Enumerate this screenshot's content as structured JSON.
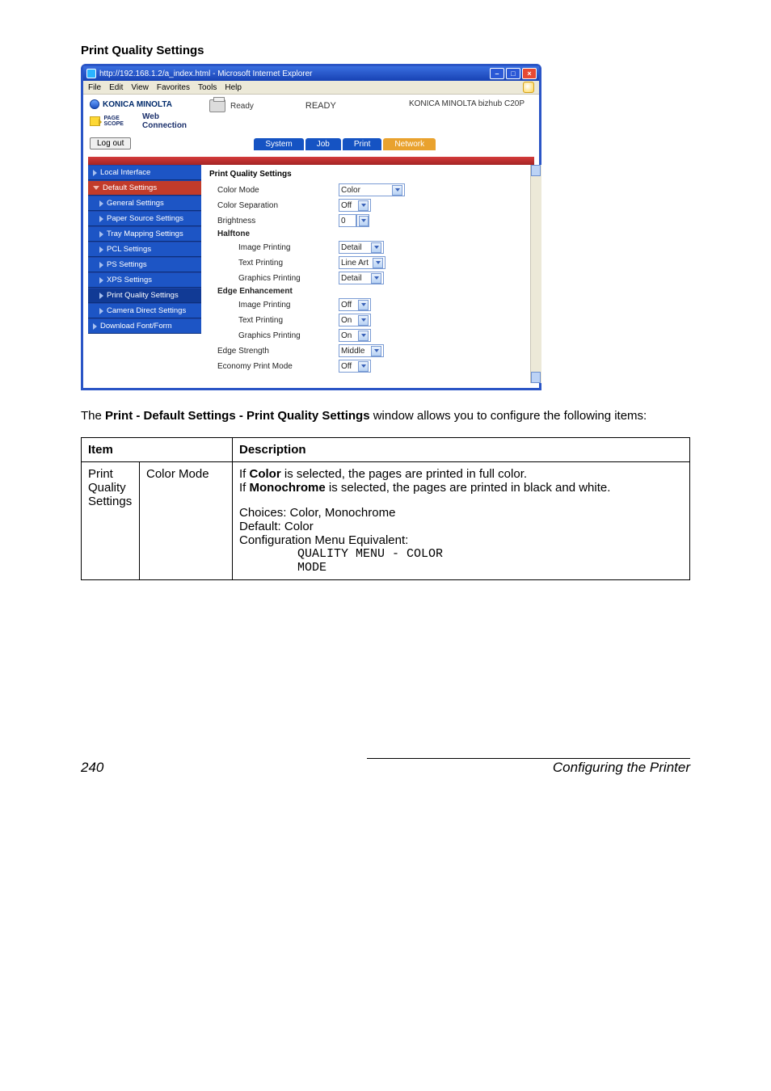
{
  "heading": "Print Quality Settings",
  "browser": {
    "title": "http://192.168.1.2/a_index.html - Microsoft Internet Explorer",
    "menu": {
      "file": "File",
      "edit": "Edit",
      "view": "View",
      "favorites": "Favorites",
      "tools": "Tools",
      "help": "Help"
    }
  },
  "header": {
    "brand": "KONICA MINOLTA",
    "pagescope_prefix": "PAGE SCOPE",
    "pagescope": "Web Connection",
    "status_small": "Ready",
    "status_big": "READY",
    "model": "KONICA MINOLTA bizhub C20P",
    "logout": "Log out"
  },
  "tabs": {
    "system": "System",
    "job": "Job",
    "print": "Print",
    "network": "Network"
  },
  "sidebar": {
    "local_interface": "Local Interface",
    "default_settings": "Default Settings",
    "general": "General Settings",
    "paper_source": "Paper Source Settings",
    "tray_mapping": "Tray Mapping Settings",
    "pcl": "PCL Settings",
    "ps": "PS Settings",
    "xps": "XPS Settings",
    "print_quality": "Print Quality Settings",
    "camera": "Camera Direct Settings",
    "download": "Download Font/Form"
  },
  "pane": {
    "title": "Print Quality Settings",
    "color_mode": {
      "label": "Color Mode",
      "value": "Color"
    },
    "color_sep": {
      "label": "Color Separation",
      "value": "Off"
    },
    "brightness": {
      "label": "Brightness",
      "value": "0"
    },
    "halftone": {
      "label": "Halftone",
      "image": {
        "label": "Image Printing",
        "value": "Detail"
      },
      "text": {
        "label": "Text Printing",
        "value": "Line Art"
      },
      "graphics": {
        "label": "Graphics Printing",
        "value": "Detail"
      }
    },
    "edge": {
      "label": "Edge Enhancement",
      "image": {
        "label": "Image Printing",
        "value": "Off"
      },
      "text": {
        "label": "Text Printing",
        "value": "On"
      },
      "graphics": {
        "label": "Graphics Printing",
        "value": "On"
      }
    },
    "edge_strength": {
      "label": "Edge Strength",
      "value": "Middle"
    },
    "economy": {
      "label": "Economy Print Mode",
      "value": "Off"
    }
  },
  "bodytext": {
    "pre": "The ",
    "bold": "Print - Default Settings - Print Quality Settings",
    "post": " window allows you to configure the following items:"
  },
  "table": {
    "h_item": "Item",
    "h_desc": "Description",
    "group": "Print Quality Settings",
    "param": "Color Mode",
    "desc": {
      "l1a": "If ",
      "l1b": "Color",
      "l1c": " is selected, the pages are printed in full color.",
      "l2a": "If ",
      "l2b": "Monochrome",
      "l2c": " is selected, the pages are printed in black and white.",
      "choices": "Choices: Color, Monochrome",
      "default": "Default:  Color",
      "cfg": "Configuration Menu Equivalent:",
      "mono1": "QUALITY MENU - COLOR",
      "mono2": "MODE"
    }
  },
  "footer": {
    "page": "240",
    "title": "Configuring the Printer"
  }
}
